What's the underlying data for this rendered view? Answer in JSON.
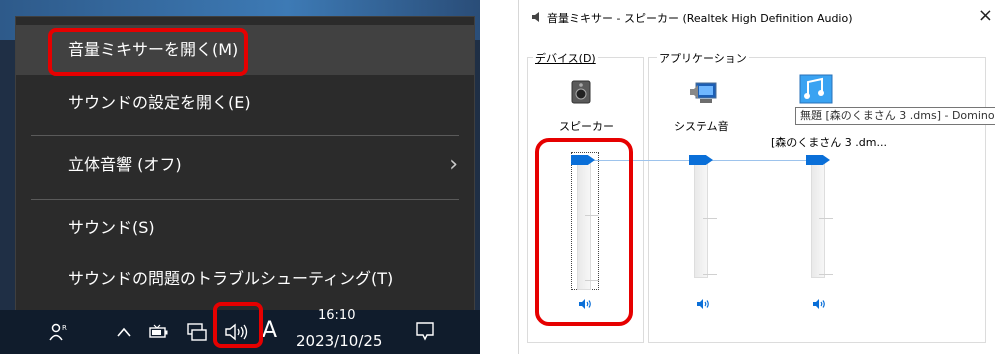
{
  "menu": {
    "items": [
      {
        "label": "音量ミキサーを開く(M)"
      },
      {
        "label": "サウンドの設定を開く(E)"
      },
      {
        "label": "立体音響 (オフ)"
      },
      {
        "label": "サウンド(S)"
      },
      {
        "label": "サウンドの問題のトラブルシューティング(T)"
      }
    ]
  },
  "taskbar": {
    "clock_time": "16:10",
    "clock_date": "2023/10/25",
    "ime": "A"
  },
  "mixer": {
    "title": "音量ミキサー - スピーカー (Realtek High Definition Audio)",
    "close_glyph": "×",
    "device_group": "デバイス(D)",
    "app_group": "アプリケーション",
    "device_label": "スピーカー",
    "system_label": "システム音",
    "app_label": "[森のくまさん 3 .dm...",
    "tooltip": "無題 [森のくまさん 3 .dms] - Domino",
    "levels": {
      "device": 1.0,
      "system": 1.0,
      "app": 1.0
    }
  },
  "colors": {
    "highlight": "#e60000",
    "thumb": "#0a6fd8"
  },
  "icons": [
    "volume-icon",
    "person-icon",
    "chevron-up-icon",
    "battery-icon",
    "network-icon",
    "notification-icon",
    "speaker-device-icon",
    "system-sounds-icon",
    "music-app-icon",
    "speaker-mute-button-icon"
  ]
}
